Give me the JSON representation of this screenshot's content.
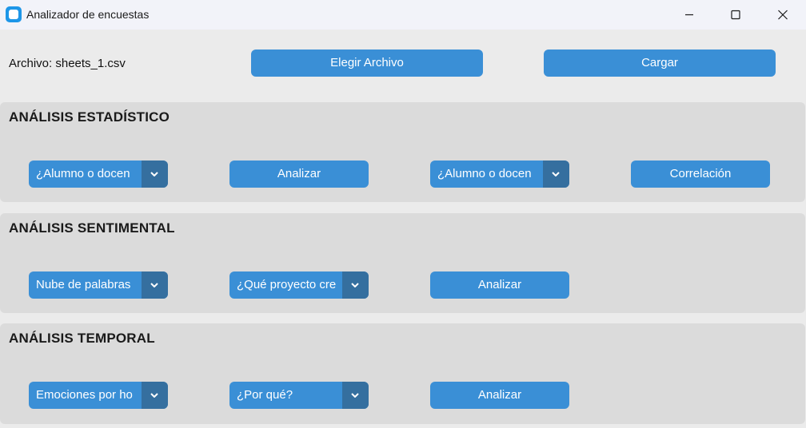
{
  "window": {
    "title": "Analizador de encuestas",
    "icons": [
      "app-icon",
      "minimize-icon",
      "maximize-icon",
      "close-icon"
    ]
  },
  "file": {
    "label": "Archivo: sheets_1.csv",
    "choose_label": "Elegir Archivo",
    "load_label": "Cargar"
  },
  "sections": {
    "statistical": {
      "title": "ANÁLISIS ESTADÍSTICO",
      "combo1_value": "¿Alumno  o docen",
      "analyze_label": "Analizar",
      "combo2_value": "¿Alumno  o docen",
      "correlation_label": "Correlación"
    },
    "sentiment": {
      "title": "ANÁLISIS SENTIMENTAL",
      "combo1_value": "Nube de palabras",
      "combo2_value": "¿Qué proyecto cre",
      "analyze_label": "Analizar"
    },
    "temporal": {
      "title": "ANÁLISIS TEMPORAL",
      "combo1_value": "Emociones por ho",
      "combo2_value": "¿Por qué?",
      "analyze_label": "Analizar"
    }
  },
  "colors": {
    "accent": "#3a8fd6",
    "accent_dark": "#356f9f",
    "background": "#ebebeb",
    "panel": "#dbdbdb",
    "titlebar": "#f2f3f9"
  }
}
